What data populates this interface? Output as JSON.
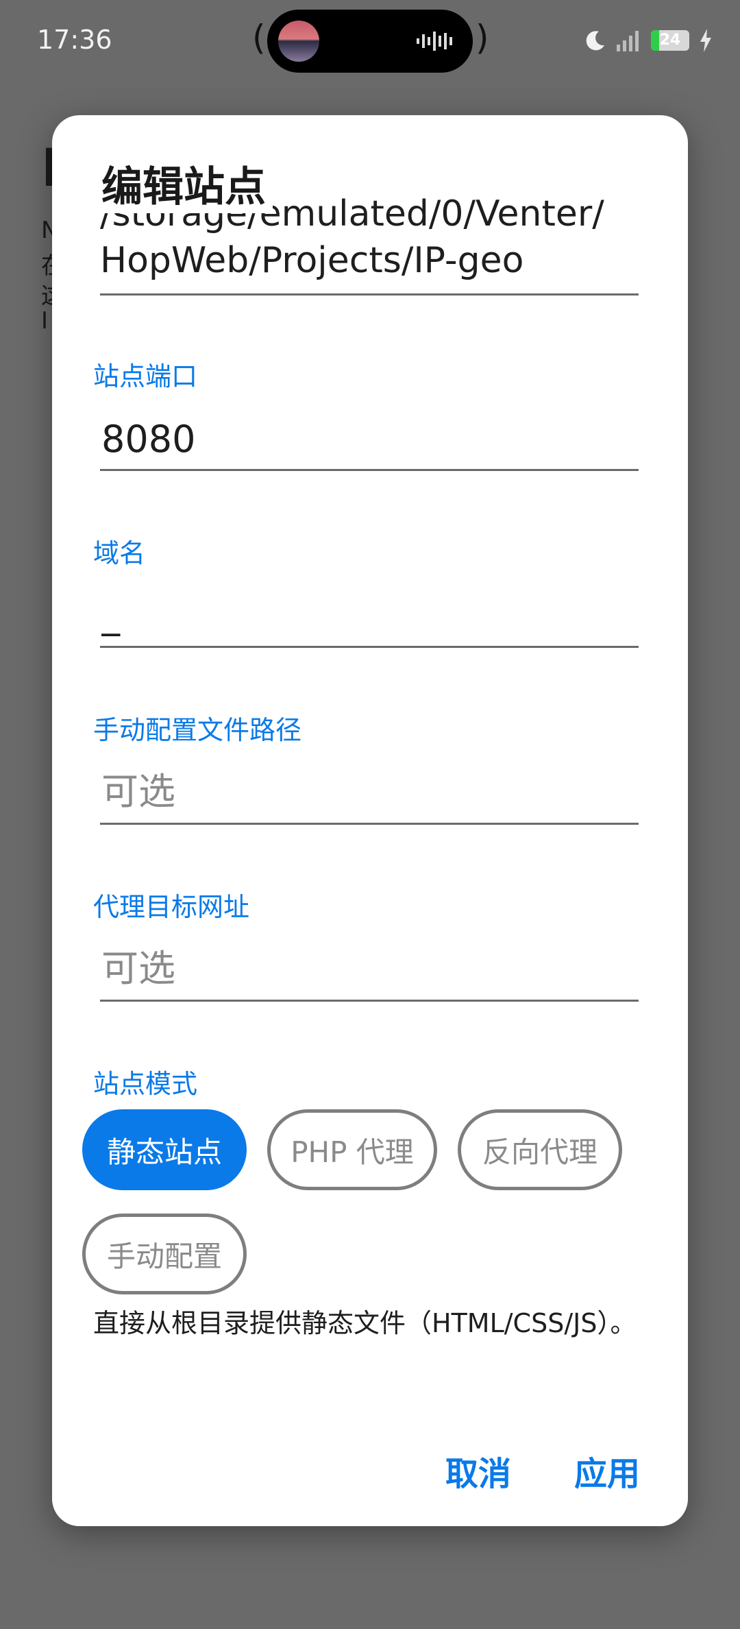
{
  "status_bar": {
    "time": "17:36",
    "battery_level": "24"
  },
  "dialog": {
    "title": "编辑站点",
    "root_path": {
      "line1": "/storage/emulated/0/Venter/",
      "line2": "HopWeb/Projects/IP-geo"
    },
    "port": {
      "label": "站点端口",
      "value": "8080"
    },
    "domain": {
      "label": "域名",
      "value": "_"
    },
    "config_path": {
      "label": "手动配置文件路径",
      "placeholder": "可选"
    },
    "proxy_target": {
      "label": "代理目标网址",
      "placeholder": "可选"
    },
    "mode": {
      "label": "站点模式",
      "options": [
        "静态站点",
        "PHP 代理",
        "反向代理",
        "手动配置"
      ],
      "selected": "静态站点",
      "description": "直接从根目录提供静态文件（HTML/CSS/JS）。"
    },
    "cancel_label": "取消",
    "apply_label": "应用"
  },
  "colors": {
    "accent": "#0a7ae8",
    "scrim": "#5f5f5f",
    "battery_fill": "#2fcd4a"
  }
}
